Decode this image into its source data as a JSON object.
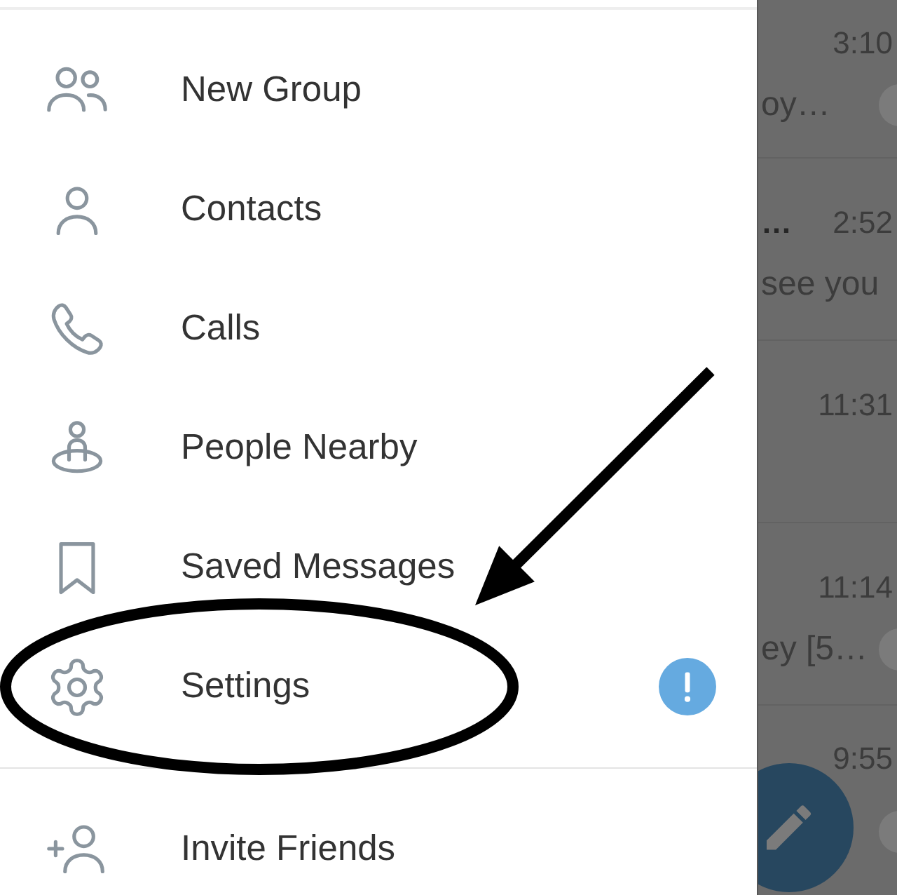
{
  "menu": [
    {
      "kind": "new-group",
      "label": "New Group",
      "alert": false,
      "circled": false
    },
    {
      "kind": "contacts",
      "label": "Contacts",
      "alert": false,
      "circled": false
    },
    {
      "kind": "calls",
      "label": "Calls",
      "alert": false,
      "circled": false
    },
    {
      "kind": "nearby",
      "label": "People Nearby",
      "alert": false,
      "circled": false
    },
    {
      "kind": "saved",
      "label": "Saved Messages",
      "alert": false,
      "circled": false
    },
    {
      "kind": "settings",
      "label": "Settings",
      "alert": true,
      "circled": true
    }
  ],
  "footer_menu": [
    {
      "kind": "invite",
      "label": "Invite Friends",
      "alert": false,
      "circled": false
    }
  ],
  "chats": [
    {
      "time": "3:10",
      "preview": "oy…",
      "unread": true
    },
    {
      "title": "…",
      "time": "2:52",
      "preview": "see you",
      "unread": false
    },
    {
      "time": "11:31",
      "unread": false
    },
    {
      "time": "11:14",
      "preview": "ey [5…",
      "unread": true
    },
    {
      "time": "9:55",
      "unread": true
    }
  ]
}
